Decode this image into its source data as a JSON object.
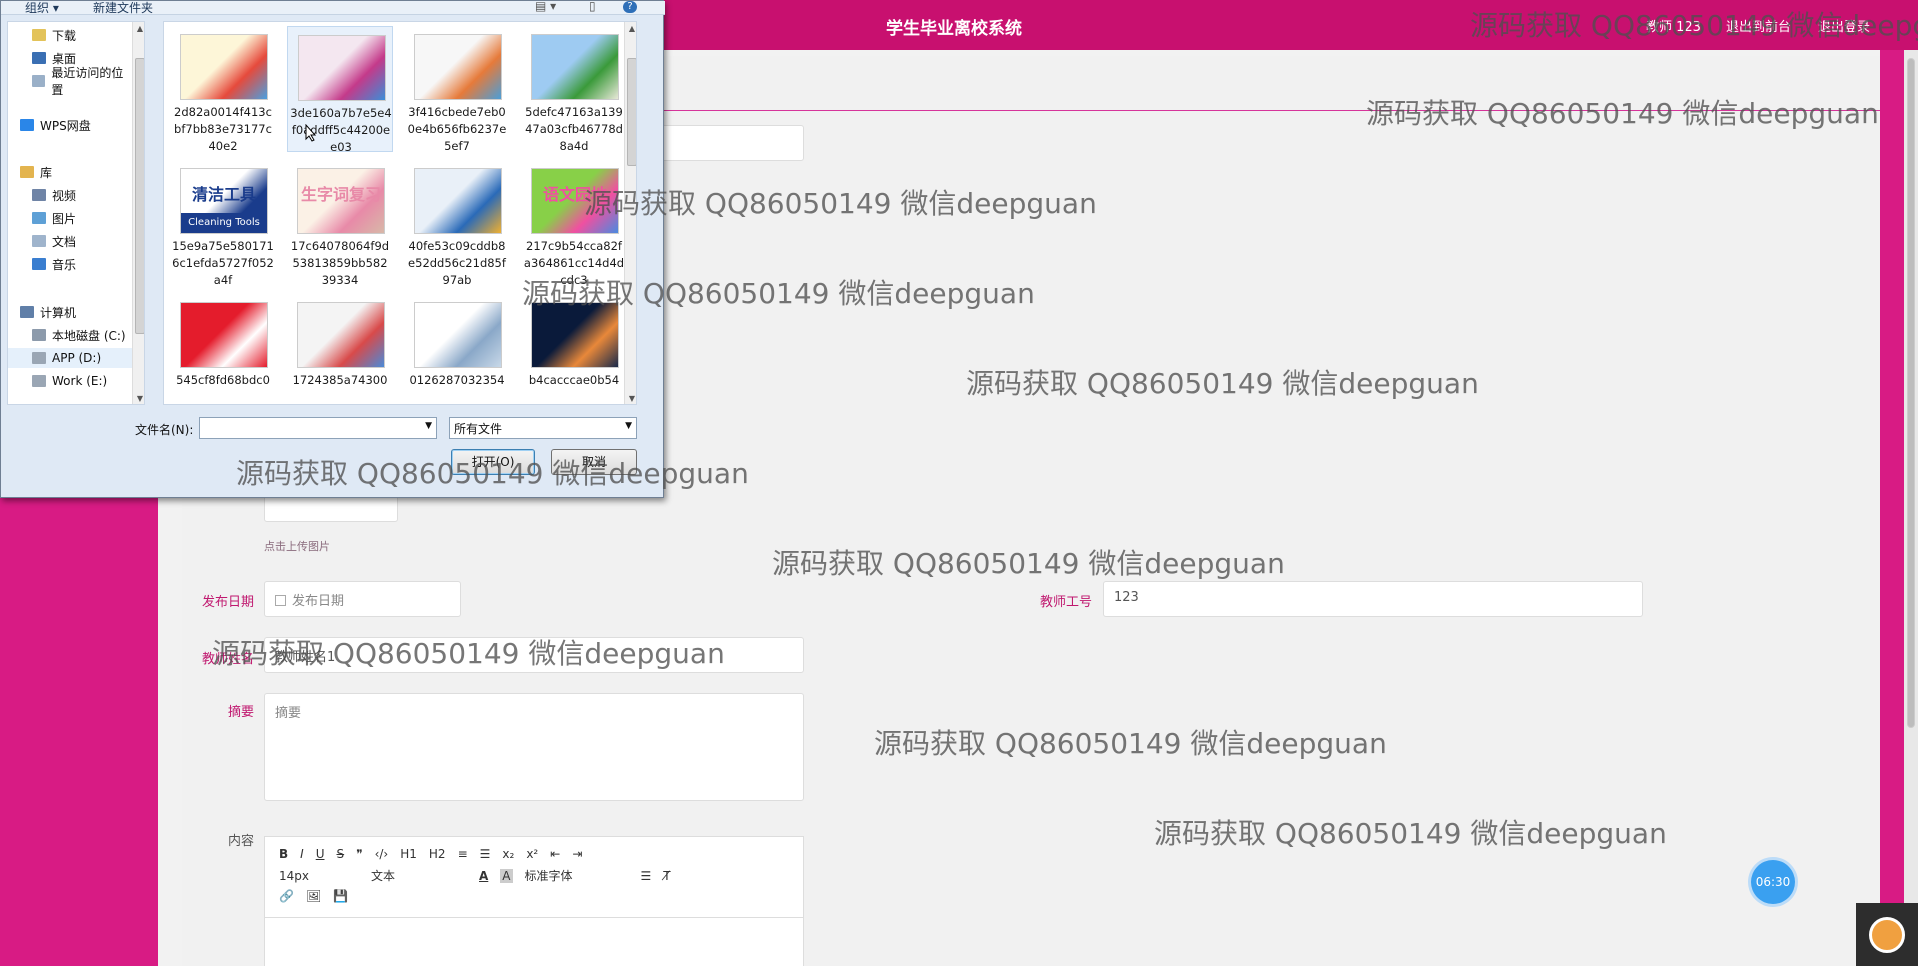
{
  "app": {
    "title": "学生毕业离校系统",
    "user_label": "教师 123",
    "back_to_front": "退出到前台",
    "logout": "退出登录"
  },
  "form": {
    "upload_hint": "点击上传图片",
    "publish_date_label": "发布日期",
    "publish_date_placeholder": "发布日期",
    "teacher_id_label": "教师工号",
    "teacher_id_value": "123",
    "teacher_name_label": "教师姓名",
    "teacher_name_value": "教师姓名1",
    "summary_label": "摘要",
    "summary_placeholder": "摘要",
    "content_label": "内容"
  },
  "editor": {
    "row1": [
      "B",
      "I",
      "U",
      "S",
      "❞",
      "‹/›",
      "H1",
      "H2",
      "≡",
      "☰",
      "x₂",
      "x²",
      "⇤",
      "⇥"
    ],
    "font_size": "14px",
    "block_type": "文本",
    "font_family": "标准字体",
    "row3": [
      "🔗",
      "🖼",
      "💾"
    ]
  },
  "time_bubble": "06:30",
  "dialog": {
    "toolbar": {
      "organize": "组织 ▾",
      "new_folder": "新建文件夹"
    },
    "nav": [
      {
        "label": "下载",
        "color": "#e3c35a"
      },
      {
        "label": "桌面",
        "color": "#3a6fb3"
      },
      {
        "label": "最近访问的位置",
        "color": "#9ab0c8"
      },
      {
        "label": "WPS网盘",
        "color": "#2a86e8"
      },
      {
        "label": "库",
        "color": "#e3b44f"
      },
      {
        "label": "视频",
        "color": "#6f84a6"
      },
      {
        "label": "图片",
        "color": "#5ea0d6"
      },
      {
        "label": "文档",
        "color": "#9fb4cc"
      },
      {
        "label": "音乐",
        "color": "#3a7ed0"
      },
      {
        "label": "计算机",
        "color": "#607fa8"
      },
      {
        "label": "本地磁盘 (C:)",
        "color": "#8c9aab"
      },
      {
        "label": "APP (D:)",
        "color": "#9aa6b4"
      },
      {
        "label": "Work (E:)",
        "color": "#9aa6b4"
      }
    ],
    "files": [
      {
        "name": "2d82a0014f413cbf7bb83e73177c40e2",
        "colors": [
          "#fdf6d8",
          "#e64a3c",
          "#4aa0e0"
        ]
      },
      {
        "name": "3de160a7b7e5e4f0addff5c44200ee03",
        "colors": [
          "#f4e7f0",
          "#c43a8a",
          "#3a8ed8"
        ]
      },
      {
        "name": "3f416cbede7eb00e4b656fb6237e5ef7",
        "colors": [
          "#f7f7f7",
          "#e67a3a",
          "#4a9ed8"
        ]
      },
      {
        "name": "5defc47163a13947a03cfb46778d8a4d",
        "colors": [
          "#9ecbf2",
          "#3a9a3a",
          "#e8e8d8"
        ]
      },
      {
        "name": "15e9a75e5801716c1efda5727f052a4f",
        "colors": [
          "#ffffff",
          "#1a3c8c",
          "#1a3c8c"
        ],
        "text": "清洁工具",
        "sub": "Cleaning Tools"
      },
      {
        "name": "17c64078064f9d53813859bb58239334",
        "colors": [
          "#fbf1e6",
          "#e88aa8",
          "#d8b8a8"
        ],
        "text": "生字词复习"
      },
      {
        "name": "40fe53c09cddb8e52dd56c21d85f97ab",
        "colors": [
          "#e9f0f8",
          "#2a6ab8",
          "#f0b030"
        ]
      },
      {
        "name": "217c9b54cca82fa364861cc14d4dcdc3",
        "colors": [
          "#88d048",
          "#f050a0",
          "#4a8ae0"
        ],
        "text": "语文园地"
      },
      {
        "name": "545cf8fd68bdc0",
        "colors": [
          "#e41c2c",
          "#ffffff",
          "#e41c2c"
        ]
      },
      {
        "name": "1724385a74300",
        "colors": [
          "#f4f4f4",
          "#d84a4a",
          "#4a8ad8"
        ]
      },
      {
        "name": "0126287032354",
        "colors": [
          "#ffffff",
          "#8aa8c8",
          "#c8d8e8"
        ]
      },
      {
        "name": "b4cacccae0b54",
        "colors": [
          "#0a1a3a",
          "#e8883a",
          "#1a2a4a"
        ]
      }
    ],
    "filename_label": "文件名(N):",
    "filename_value": "",
    "filetype_value": "所有文件",
    "open_button": "打开(O)",
    "cancel_button": "取消"
  },
  "watermark": "源码获取 QQ86050149 微信deepguan"
}
